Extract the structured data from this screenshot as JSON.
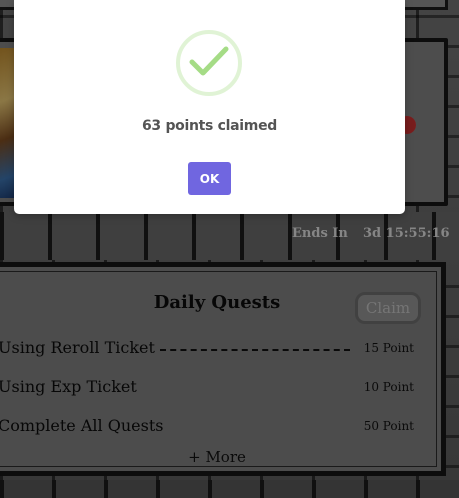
{
  "background": {
    "ends_in_label": "Ends In",
    "ends_in_value": "3d 15:55:16"
  },
  "daily_quests": {
    "title": "Daily Quests",
    "claim_label": "Claim",
    "quests": [
      {
        "name": "Using Reroll Ticket",
        "points": "15 Point"
      },
      {
        "name": "Using Exp Ticket",
        "points": "10 Point"
      },
      {
        "name": "Complete All Quests",
        "points": "50 Point"
      }
    ],
    "more_label": "+ More"
  },
  "dialog": {
    "icon": "success-check-icon",
    "message": "63 points claimed",
    "ok_label": "OK",
    "colors": {
      "confirm": "#7066e0",
      "check": "#a5dc86",
      "text": "#545454"
    }
  }
}
